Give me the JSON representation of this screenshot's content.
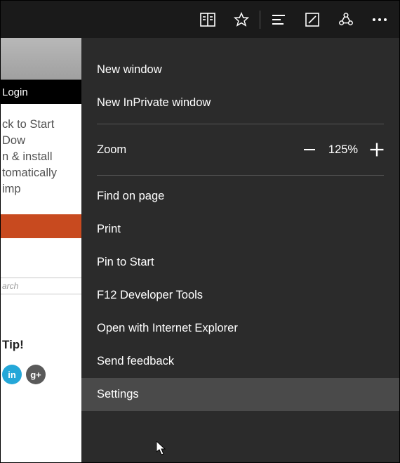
{
  "toolbar": {
    "icons": [
      "reading-list",
      "favorite-star",
      "hub-lines",
      "note",
      "share",
      "more"
    ]
  },
  "page": {
    "login_label": "Login",
    "promo_line1": "ck to Start Dow",
    "promo_line2": "n & install",
    "promo_line3": "tomatically imp",
    "search_placeholder": "arch",
    "tip_label": "Tip!",
    "social": {
      "li": "in",
      "gp": "g+"
    }
  },
  "menu": {
    "new_window": "New window",
    "new_inprivate": "New InPrivate window",
    "zoom_label": "Zoom",
    "zoom_value": "125%",
    "find": "Find on page",
    "print": "Print",
    "pin": "Pin to Start",
    "devtools": "F12 Developer Tools",
    "open_ie": "Open with Internet Explorer",
    "feedback": "Send feedback",
    "settings": "Settings"
  }
}
